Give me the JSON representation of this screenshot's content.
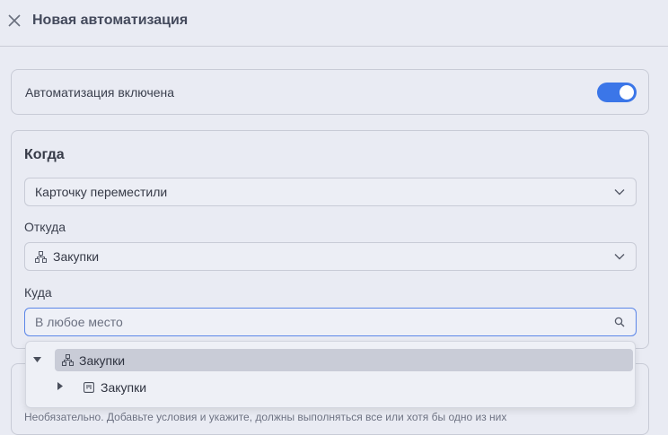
{
  "header": {
    "title": "Новая автоматизация"
  },
  "toggle_card": {
    "label": "Автоматизация включена",
    "enabled": true,
    "accent_color": "#3b76e8"
  },
  "when": {
    "title": "Когда",
    "trigger": {
      "selected": "Карточку переместили"
    },
    "from": {
      "label": "Откуда",
      "selected": "Закупки"
    },
    "to": {
      "label": "Куда",
      "placeholder": "В любое место"
    }
  },
  "dropdown": {
    "items": [
      {
        "label": "Закупки",
        "icon": "hierarchy-icon",
        "expanded": true,
        "selected": true
      },
      {
        "label": "Закупки",
        "icon": "board-icon",
        "expanded": false,
        "selected": false
      }
    ]
  },
  "footnote": "Необязательно. Добавьте условия и укажите, должны выполняться все или хотя бы одно из них"
}
